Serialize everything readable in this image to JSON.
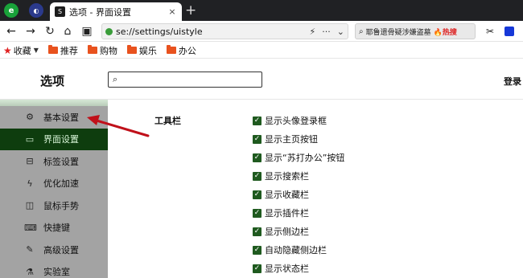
{
  "browser": {
    "tab": {
      "title": "选项 - 界面设置",
      "favicon": "S",
      "close": "×"
    },
    "new_tab": "+",
    "url": "se://settings/uistyle",
    "url_actions": {
      "bolt": "⚡",
      "more": "···",
      "chevron": "⌄"
    },
    "search": {
      "text": "耶鲁遗骨疑涉嫌盗墓",
      "hot": "🔥热搜"
    }
  },
  "bookmarks": [
    {
      "label": "收藏",
      "kind": "star"
    },
    {
      "label": "推荐",
      "kind": "folder"
    },
    {
      "label": "购物",
      "kind": "folder"
    },
    {
      "label": "娱乐",
      "kind": "folder"
    },
    {
      "label": "办公",
      "kind": "folder"
    }
  ],
  "page": {
    "title": "选项",
    "login": "登录",
    "sidebar": [
      {
        "label": "基本设置",
        "icon": "gear-icon",
        "glyph": "⚙"
      },
      {
        "label": "界面设置",
        "icon": "window-icon",
        "glyph": "▭",
        "active": true
      },
      {
        "label": "标签设置",
        "icon": "tab-icon",
        "glyph": "⊟"
      },
      {
        "label": "优化加速",
        "icon": "bolt-icon",
        "glyph": "ϟ"
      },
      {
        "label": "鼠标手势",
        "icon": "mouse-icon",
        "glyph": "◫"
      },
      {
        "label": "快捷键",
        "icon": "keyboard-icon",
        "glyph": "⌨"
      },
      {
        "label": "高级设置",
        "icon": "wrench-icon",
        "glyph": "✎"
      },
      {
        "label": "实验室",
        "icon": "flask-icon",
        "glyph": "⚗"
      }
    ],
    "section_label": "工具栏",
    "options": [
      {
        "label": "显示头像登录框",
        "checked": true
      },
      {
        "label": "显示主页按钮",
        "checked": true
      },
      {
        "label": "显示“苏打办公”按钮",
        "checked": true
      },
      {
        "label": "显示搜索栏",
        "checked": true
      },
      {
        "label": "显示收藏栏",
        "checked": true
      },
      {
        "label": "显示插件栏",
        "checked": true
      },
      {
        "label": "显示侧边栏",
        "checked": true
      },
      {
        "label": "自动隐藏侧边栏",
        "checked": true
      },
      {
        "label": "显示状态栏",
        "checked": true
      }
    ]
  },
  "colors": {
    "sidebar_bg": "#a3a3a3",
    "active_bg": "#0e3d0e",
    "checkbox": "#1f5a1f",
    "arrow": "#c0101a"
  }
}
